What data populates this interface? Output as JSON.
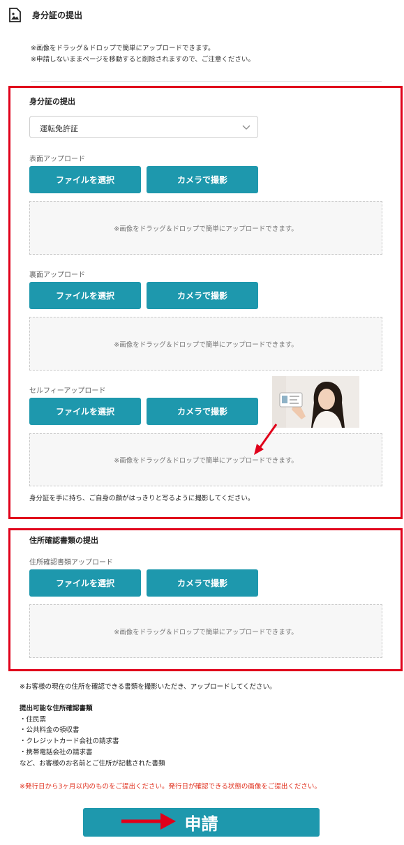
{
  "header": {
    "title": "身分証の提出",
    "note1": "※画像をドラッグ＆ドロップで簡単にアップロードできます。",
    "note2": "※申請しないままページを移動すると削除されますので、ご注意ください。"
  },
  "id_section": {
    "title": "身分証の提出",
    "doc_select": {
      "value": "運転免許証"
    },
    "front": {
      "label": "表面アップロード",
      "file_button": "ファイルを選択",
      "camera_button": "カメラで撮影",
      "dropzone": "※画像をドラッグ＆ドロップで簡単にアップロードできます。"
    },
    "back": {
      "label": "裏面アップロード",
      "file_button": "ファイルを選択",
      "camera_button": "カメラで撮影",
      "dropzone": "※画像をドラッグ＆ドロップで簡単にアップロードできます。"
    },
    "selfie": {
      "label": "セルフィーアップロード",
      "file_button": "ファイルを選択",
      "camera_button": "カメラで撮影",
      "dropzone": "※画像をドラッグ＆ドロップで簡単にアップロードできます。",
      "hint": "身分証を手に持ち、ご自身の顔がはっきりと写るように撮影してください。"
    }
  },
  "address_section": {
    "title": "住所確認書類の提出",
    "label": "住所確認書類アップロード",
    "file_button": "ファイルを選択",
    "camera_button": "カメラで撮影",
    "dropzone": "※画像をドラッグ＆ドロップで簡単にアップロードできます。"
  },
  "address_info": {
    "note": "※お客様の現在の住所を確認できる書類を撮影いただき、アップロードしてください。",
    "list_title": "提出可能な住所確認書類",
    "items": [
      "・住民票",
      "・公共料金の領収書",
      "・クレジットカード会社の請求書",
      "・携帯電話会社の請求書"
    ],
    "footer": "など、お客様のお名前とご住所が記載された書類",
    "warning": "※発行日から3ヶ月以内のものをご提出ください。発行日が確認できる状態の画像をご提出ください。"
  },
  "submit": {
    "label": "申請"
  },
  "colors": {
    "accent": "#1e98ad",
    "highlight_red": "#e0001a",
    "warning_red": "#e0301e"
  },
  "icons": [
    "image-file-icon",
    "chevron-down-icon",
    "arrow-icon"
  ]
}
